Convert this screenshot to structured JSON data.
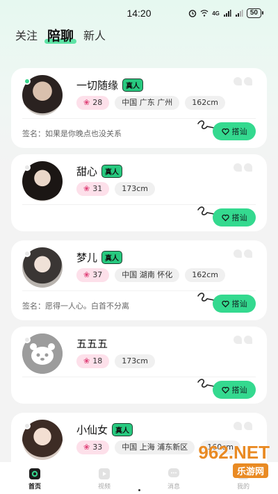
{
  "status_bar": {
    "time": "14:20",
    "battery": "50",
    "network": "4G"
  },
  "tabs": [
    {
      "label": "关注",
      "active": false
    },
    {
      "label": "陪聊",
      "active": true
    },
    {
      "label": "新人",
      "active": false
    }
  ],
  "cards": [
    {
      "name": "一切随缘",
      "badge": "真人",
      "online": true,
      "tags": [
        {
          "text": "28",
          "pink": true,
          "icon": "charm-icon"
        },
        {
          "text": "中国 广东 广州"
        },
        {
          "text": "162cm"
        }
      ],
      "signature": "签名：如果是你晚点也没关系",
      "greet": "搭讪"
    },
    {
      "name": "甜心",
      "badge": "真人",
      "online": false,
      "tags": [
        {
          "text": "31",
          "pink": true,
          "icon": "charm-icon"
        },
        {
          "text": "173cm"
        }
      ],
      "signature": "",
      "greet": "搭讪"
    },
    {
      "name": "梦儿",
      "badge": "真人",
      "online": false,
      "tags": [
        {
          "text": "37",
          "pink": true,
          "icon": "charm-icon"
        },
        {
          "text": "中国 湖南 怀化"
        },
        {
          "text": "162cm"
        }
      ],
      "signature": "签名：愿得一人心。白首不分离",
      "greet": "搭讪"
    },
    {
      "name": "五五五",
      "badge": "",
      "online": false,
      "tags": [
        {
          "text": "18",
          "pink": true,
          "icon": "charm-icon"
        },
        {
          "text": "173cm"
        }
      ],
      "signature": "",
      "greet": "搭讪"
    },
    {
      "name": "小仙女",
      "badge": "真人",
      "online": false,
      "tags": [
        {
          "text": "33",
          "pink": true,
          "icon": "charm-icon"
        },
        {
          "text": "中国 上海 浦东新区"
        },
        {
          "text": "160cm"
        }
      ],
      "signature": "",
      "greet": "搭讪"
    }
  ],
  "bottom_nav": [
    {
      "label": "首页",
      "icon": "home-icon",
      "active": true
    },
    {
      "label": "视频",
      "icon": "video-icon",
      "active": false
    },
    {
      "label": "消息",
      "icon": "message-icon",
      "active": false
    },
    {
      "label": "我的",
      "icon": "profile-icon",
      "active": false
    }
  ],
  "watermark": {
    "text": "962.NET",
    "sub": "乐游网"
  },
  "colors": {
    "accent": "#34d98f",
    "pink_tag": "#fde0ea",
    "badge": "#27c97f"
  }
}
